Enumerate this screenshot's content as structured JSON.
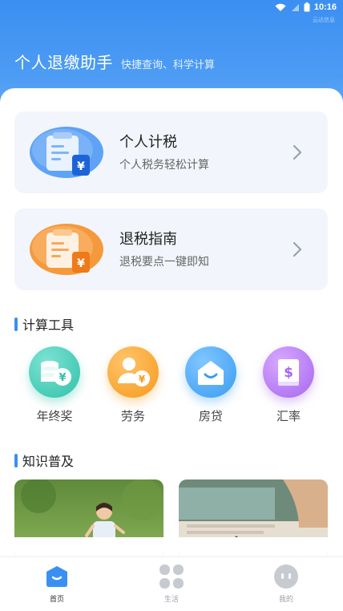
{
  "status_bar": {
    "time": "10:16",
    "sub_text": "云达信息"
  },
  "header": {
    "title": "个人退缴助手",
    "subtitle": "快捷查询、科学计算"
  },
  "cards": [
    {
      "title": "个人计税",
      "desc": "个人税务轻松计算",
      "icon": "tax-calculator-illustration",
      "color": "#3b8ff2"
    },
    {
      "title": "退税指南",
      "desc": "退税要点一键即知",
      "icon": "refund-guide-illustration",
      "color": "#f28a2e"
    }
  ],
  "sections": {
    "tools_title": "计算工具",
    "knowledge_title": "知识普及"
  },
  "tools": [
    {
      "label": "年终奖",
      "icon": "coins-yen-icon"
    },
    {
      "label": "劳务",
      "icon": "person-yen-icon"
    },
    {
      "label": "房贷",
      "icon": "house-icon"
    },
    {
      "label": "汇率",
      "icon": "dollar-book-icon"
    }
  ],
  "tabbar": [
    {
      "label": "首页",
      "icon": "home-icon",
      "active": true
    },
    {
      "label": "生活",
      "icon": "grid-icon",
      "active": false
    },
    {
      "label": "我的",
      "icon": "profile-icon",
      "active": false
    }
  ]
}
